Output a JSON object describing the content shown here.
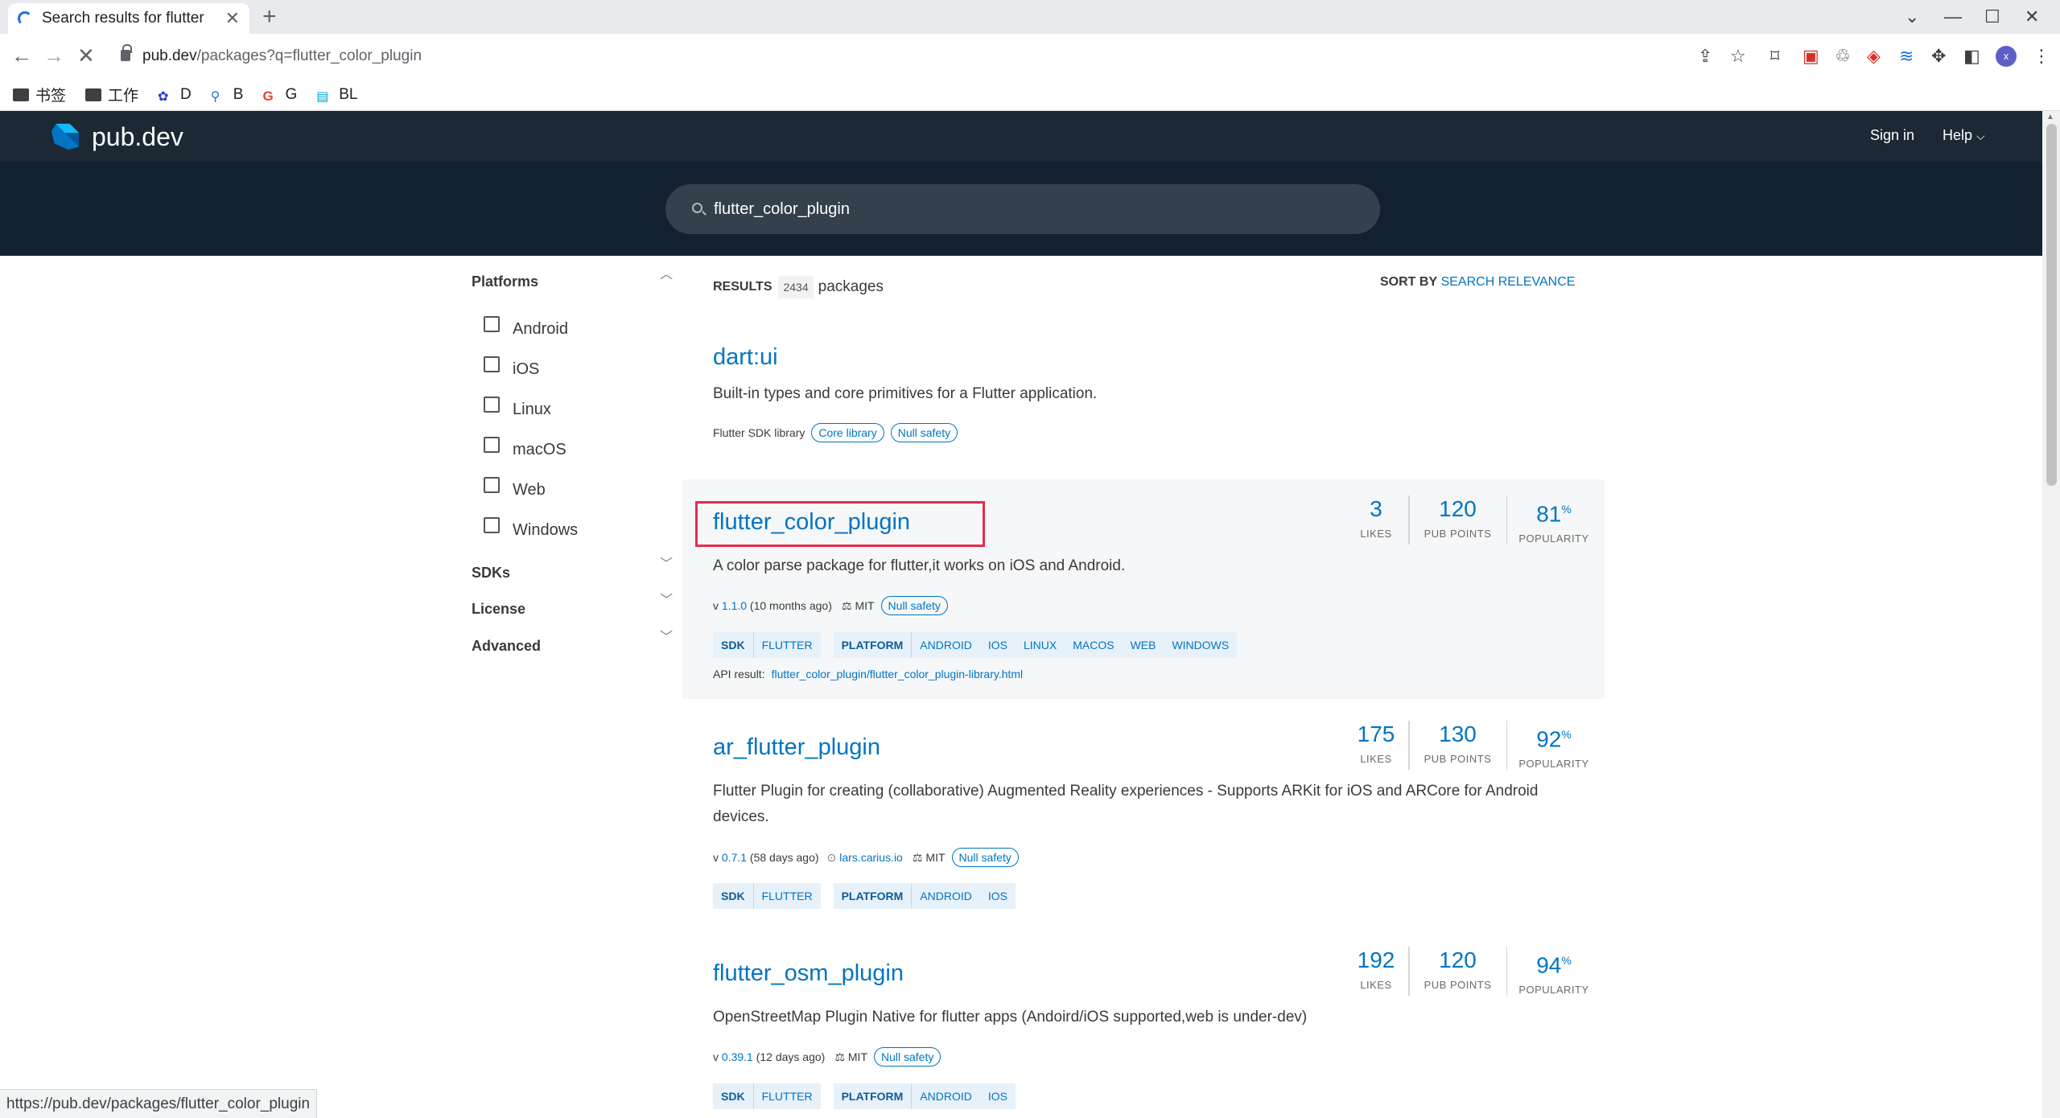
{
  "browser": {
    "tab_title": "Search results for flutter",
    "url_domain": "pub.dev",
    "url_path": "/packages?q=flutter_color_plugin",
    "bookmarks": [
      {
        "label": "书签",
        "icon": "folder-icon"
      },
      {
        "label": "工作",
        "icon": "folder-icon"
      },
      {
        "label": "D",
        "icon": "baidu-icon"
      },
      {
        "label": "B",
        "icon": "search-icon"
      },
      {
        "label": "G",
        "icon": "google-icon"
      },
      {
        "label": "BL",
        "icon": "bilibili-icon"
      }
    ],
    "status_url": "https://pub.dev/packages/flutter_color_plugin",
    "profile_initial": "x"
  },
  "header": {
    "logo_text": "pub.dev",
    "signin": "Sign in",
    "help": "Help"
  },
  "search": {
    "query": "flutter_color_plugin"
  },
  "sidebar": {
    "platforms_title": "Platforms",
    "platforms": [
      "Android",
      "iOS",
      "Linux",
      "macOS",
      "Web",
      "Windows"
    ],
    "sdks": "SDKs",
    "license": "License",
    "advanced": "Advanced"
  },
  "results": {
    "label": "RESULTS",
    "count": "2434",
    "unit": "packages",
    "sort_label": "SORT BY",
    "sort_value": "SEARCH RELEVANCE"
  },
  "packages": [
    {
      "name": "dart:ui",
      "description": "Built-in types and core primitives for a Flutter application.",
      "sdk_label": "Flutter SDK library",
      "chips": [
        "Core library",
        "Null safety"
      ]
    },
    {
      "name": "flutter_color_plugin",
      "description": "A color parse package for flutter,it works on iOS and Android.",
      "version_prefix": "v",
      "version": "1.1.0",
      "age": "(10 months ago)",
      "license": "MIT",
      "chip": "Null safety",
      "sdk_key": "SDK",
      "sdk_values": [
        "FLUTTER"
      ],
      "platform_key": "PLATFORM",
      "platform_values": [
        "ANDROID",
        "IOS",
        "LINUX",
        "MACOS",
        "WEB",
        "WINDOWS"
      ],
      "api_label": "API result:",
      "api_link": "flutter_color_plugin/flutter_color_plugin-library.html",
      "likes": "3",
      "pub_points": "120",
      "popularity": "81",
      "likes_label": "LIKES",
      "points_label": "PUB POINTS",
      "popularity_label": "POPULARITY",
      "percent": "%"
    },
    {
      "name": "ar_flutter_plugin",
      "description": "Flutter Plugin for creating (collaborative) Augmented Reality experiences - Supports ARKit for iOS and ARCore for Android devices.",
      "version_prefix": "v",
      "version": "0.7.1",
      "age": "(58 days ago)",
      "publisher": "lars.carius.io",
      "license": "MIT",
      "chip": "Null safety",
      "sdk_key": "SDK",
      "sdk_values": [
        "FLUTTER"
      ],
      "platform_key": "PLATFORM",
      "platform_values": [
        "ANDROID",
        "IOS"
      ],
      "likes": "175",
      "pub_points": "130",
      "popularity": "92",
      "likes_label": "LIKES",
      "points_label": "PUB POINTS",
      "popularity_label": "POPULARITY",
      "percent": "%"
    },
    {
      "name": "flutter_osm_plugin",
      "description": "OpenStreetMap Plugin Native for flutter apps (Andoird/iOS supported,web is under-dev)",
      "version_prefix": "v",
      "version": "0.39.1",
      "age": "(12 days ago)",
      "license": "MIT",
      "chip": "Null safety",
      "sdk_key": "SDK",
      "sdk_values": [
        "FLUTTER"
      ],
      "platform_key": "PLATFORM",
      "platform_values": [
        "ANDROID",
        "IOS"
      ],
      "likes": "192",
      "pub_points": "120",
      "popularity": "94",
      "likes_label": "LIKES",
      "points_label": "PUB POINTS",
      "popularity_label": "POPULARITY",
      "percent": "%"
    }
  ],
  "colors": {
    "header_bg": "#1c2834",
    "search_band": "#132030",
    "link_blue": "#0175c2",
    "highlight_red": "#e52b50"
  }
}
